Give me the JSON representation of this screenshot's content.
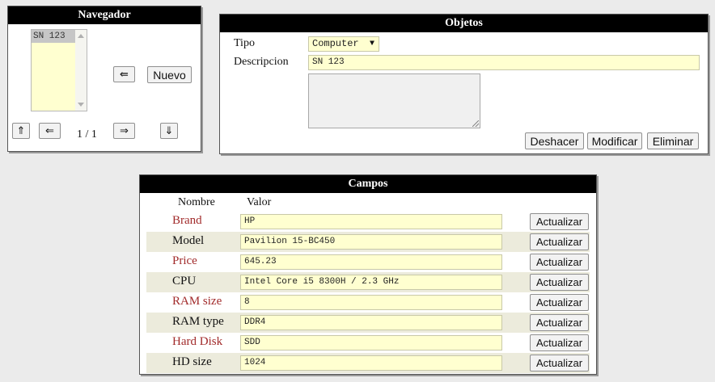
{
  "navegador": {
    "title": "Navegador",
    "list_items": [
      "SN 123"
    ],
    "counter": "1 / 1",
    "buttons": {
      "first": "⇑",
      "prev": "⇐",
      "next": "⇒",
      "last": "⇓",
      "back": "⇚",
      "new": "Nuevo"
    }
  },
  "objetos": {
    "title": "Objetos",
    "tipo_label": "Tipo",
    "tipo_value": "Computer",
    "descripcion_label": "Descripcion",
    "descripcion_value": "SN 123",
    "textarea_value": "",
    "buttons": {
      "undo": "Deshacer",
      "modify": "Modificar",
      "delete": "Eliminar"
    }
  },
  "campos": {
    "title": "Campos",
    "col_name": "Nombre",
    "col_value": "Valor",
    "update_label": "Actualizar",
    "rows": [
      {
        "name": "Brand",
        "value": "HP",
        "color": "#a12a2a"
      },
      {
        "name": "Model",
        "value": "Pavilion 15-BC450",
        "color": "#111111"
      },
      {
        "name": "Price",
        "value": "645.23",
        "color": "#a12a2a"
      },
      {
        "name": "CPU",
        "value": "Intel Core i5 8300H / 2.3 GHz",
        "color": "#111111"
      },
      {
        "name": "RAM size",
        "value": "8",
        "color": "#a12a2a"
      },
      {
        "name": "RAM type",
        "value": "DDR4",
        "color": "#111111"
      },
      {
        "name": "Hard Disk",
        "value": "SDD",
        "color": "#a12a2a"
      },
      {
        "name": "HD size",
        "value": "1024",
        "color": "#111111"
      }
    ]
  }
}
